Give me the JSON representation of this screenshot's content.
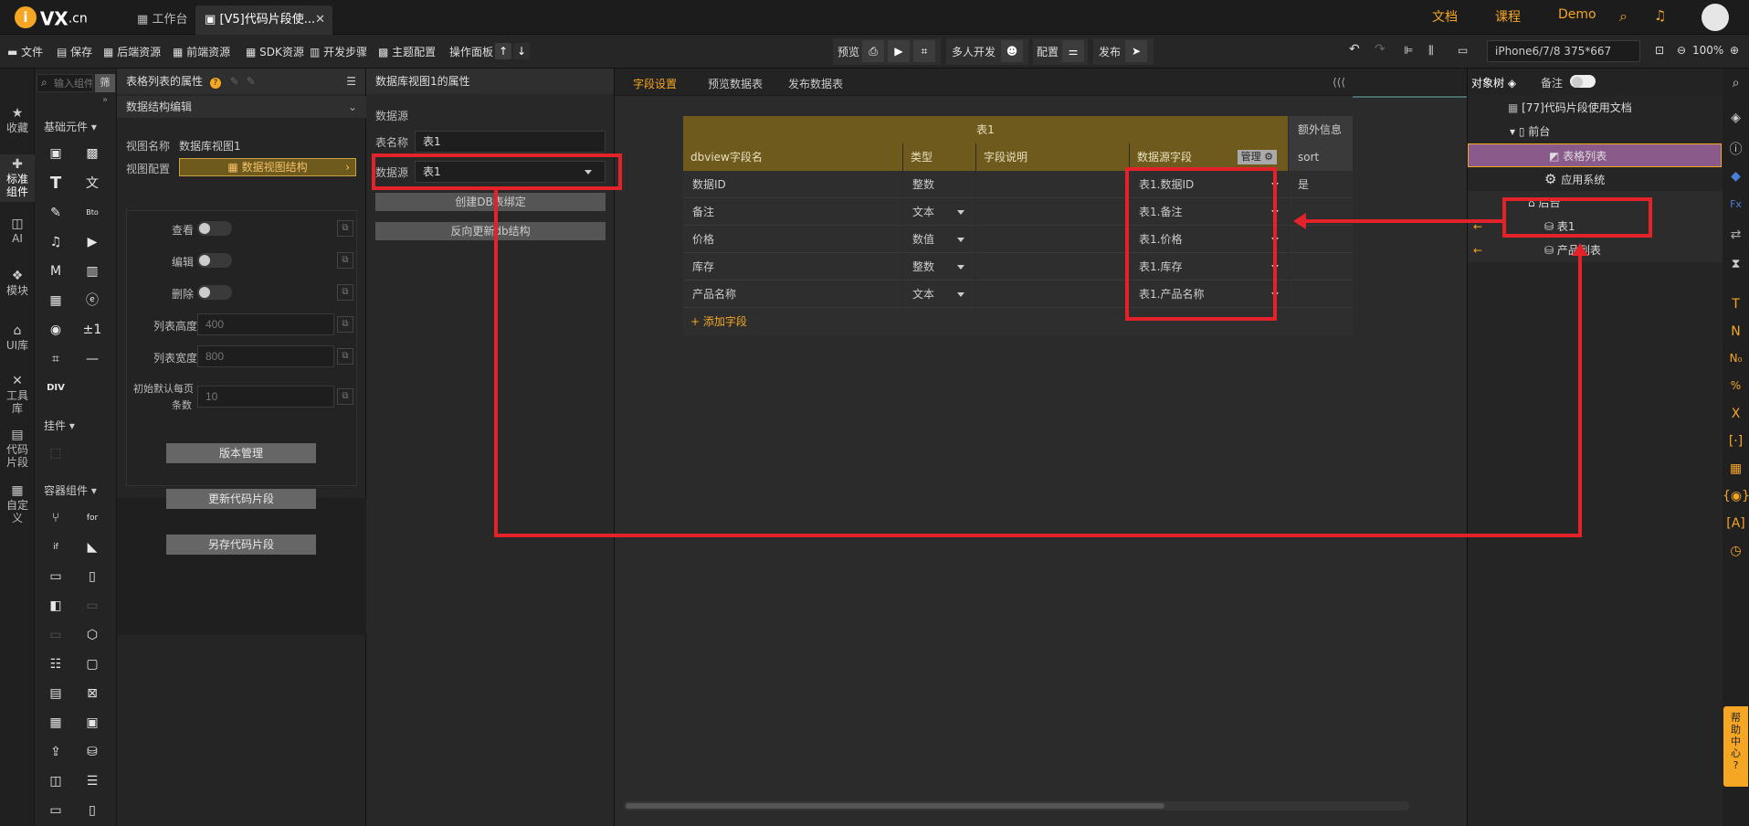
{
  "topbar": {
    "logo": "VX",
    "logo_suffix": ".cn",
    "tabs": [
      {
        "label": "工作台"
      },
      {
        "label": "[V5]代码片段使..."
      }
    ],
    "nav": {
      "docs": "文档",
      "course": "课程",
      "demo": "Demo"
    }
  },
  "toolbar": {
    "file": "文件",
    "save": "保存",
    "backend": "后端资源",
    "frontend": "前端资源",
    "sdk": "SDK资源",
    "devsteps": "开发步骤",
    "theme": "主题配置",
    "opspanel": "操作面板",
    "preview": "预览",
    "multi_dev": "多人开发",
    "config": "配置",
    "publish": "发布",
    "device": "iPhone6/7/8 375*667",
    "zoom": "100%"
  },
  "left_rail": {
    "items": [
      {
        "label": "收藏",
        "icon": "star-icon"
      },
      {
        "label": "标准组件",
        "icon": "puzzle-icon"
      },
      {
        "label": "AI",
        "icon": "ai-icon"
      },
      {
        "label": "模块",
        "icon": "module-icon"
      },
      {
        "label": "UI库",
        "icon": "ui-library-icon"
      },
      {
        "label": "工具库",
        "icon": "tools-icon"
      },
      {
        "label": "代码片段",
        "icon": "code-snippet-icon"
      },
      {
        "label": "自定义",
        "icon": "custom-icon"
      }
    ]
  },
  "palette": {
    "search_placeholder": "输入组件名称",
    "filter": "筛",
    "section_basic": "基础元件",
    "section_mount": "挂件",
    "section_container": "容器组件",
    "div_label": "DIV",
    "plusminus": "±1",
    "bto": "Bto",
    "for_label": "for",
    "if_label": "if"
  },
  "props_panel": {
    "title": "表格列表的属性",
    "section": "数据结构编辑",
    "view_name_label": "视图名称",
    "view_name_value": "数据库视图1",
    "view_config_label": "视图配置",
    "view_config_button": "数据视图结构",
    "view_label": "查看",
    "edit_label": "编辑",
    "delete_label": "删除",
    "list_height_label": "列表高度",
    "list_height_placeholder": "400",
    "list_width_label": "列表宽度",
    "list_width_placeholder": "800",
    "per_page_label_1": "初始默认每页",
    "per_page_label_2": "条数",
    "per_page_placeholder": "10",
    "btn_version": "版本管理",
    "btn_update": "更新代码片段",
    "btn_saveas": "另存代码片段"
  },
  "db_panel": {
    "title": "数据库视图1的属性",
    "section": "数据源",
    "table_name_label": "表名称",
    "table_name_value": "表1",
    "datasource_label": "数据源",
    "datasource_value": "表1",
    "btn_create": "创建DB表绑定",
    "btn_reverse": "反向更新db结构"
  },
  "main": {
    "tabs": [
      "字段设置",
      "预览数据表",
      "发布数据表"
    ],
    "table_title": "表1",
    "extra_header": "额外信息",
    "headers": [
      "dbview字段名",
      "类型",
      "字段说明",
      "数据源字段"
    ],
    "manage": "管理",
    "sort": "sort",
    "rows": [
      {
        "name": "数据ID",
        "type": "整数",
        "source": "表1.数据ID",
        "extra": "是"
      },
      {
        "name": "备注",
        "type": "文本",
        "source": "表1.备注",
        "extra": ""
      },
      {
        "name": "价格",
        "type": "数值",
        "source": "表1.价格",
        "extra": ""
      },
      {
        "name": "库存",
        "type": "整数",
        "source": "表1.库存",
        "extra": ""
      },
      {
        "name": "产品名称",
        "type": "文本",
        "source": "表1.产品名称",
        "extra": ""
      }
    ],
    "add_field": "+ 添加字段"
  },
  "right_panel": {
    "tab_tree": "对象树",
    "tab_notes": "备注",
    "tree": [
      {
        "label": "[77]代码片段使用文档"
      },
      {
        "label": "前台"
      },
      {
        "label": "表格列表"
      },
      {
        "label": "应用系统"
      },
      {
        "label": "后台"
      },
      {
        "label": "表1"
      },
      {
        "label": "产品列表"
      }
    ]
  },
  "help": "帮助中心",
  "colors": {
    "accent": "#f5a623",
    "annotation": "#e3222a",
    "header_gold": "#6e5a1c",
    "selected": "#8a5a8a"
  }
}
